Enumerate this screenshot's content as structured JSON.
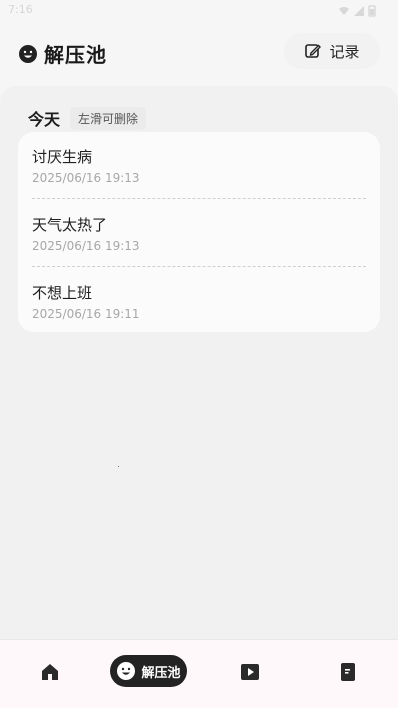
{
  "status_bar": {
    "time": "7:16"
  },
  "header": {
    "title": "解压池",
    "record_button_label": "记录"
  },
  "section": {
    "title": "今天",
    "hint": "左滑可删除"
  },
  "entries": [
    {
      "title": "讨厌生病",
      "time": "2025/06/16 19:13"
    },
    {
      "title": "天气太热了",
      "time": "2025/06/16 19:13"
    },
    {
      "title": "不想上班",
      "time": "2025/06/16 19:11"
    }
  ],
  "bottom_nav": {
    "active_label": "解压池",
    "items": [
      {
        "icon": "home-icon"
      },
      {
        "icon": "smile-icon"
      },
      {
        "icon": "play-icon"
      },
      {
        "icon": "book-icon"
      }
    ]
  },
  "colors": {
    "background": "#f6f6f6",
    "card": "#fbfbfb",
    "accent_dark": "#232323",
    "muted_text": "#a7a7a7"
  }
}
